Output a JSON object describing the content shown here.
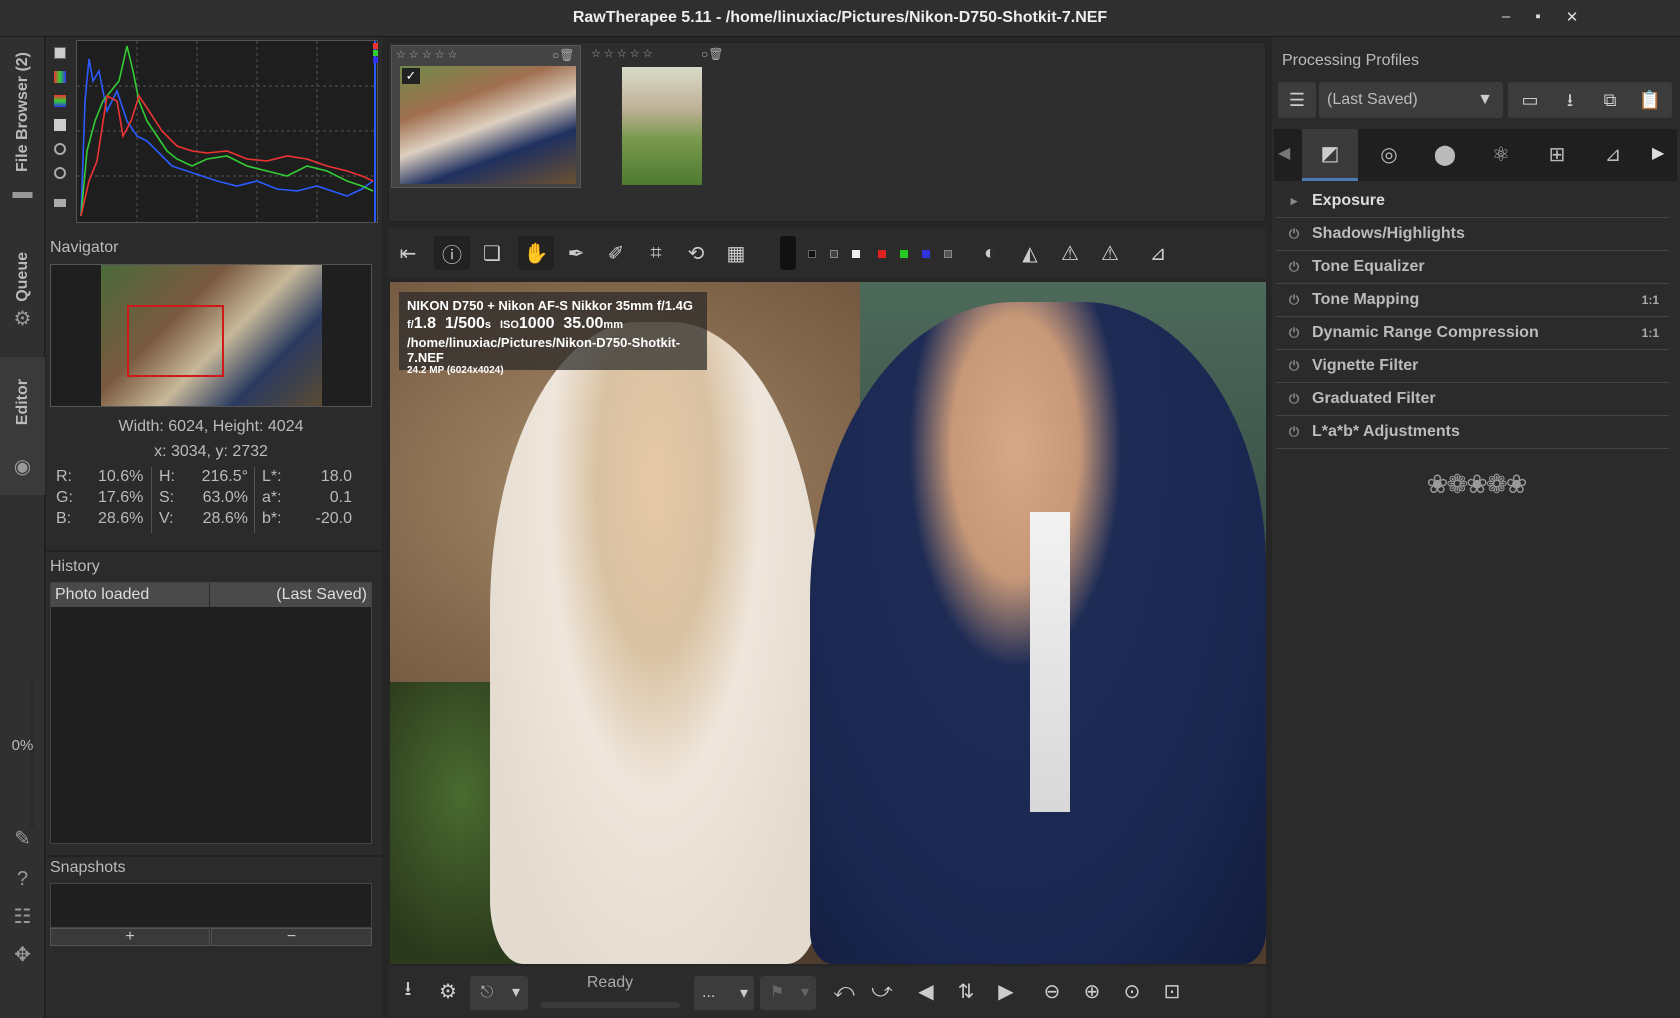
{
  "window": {
    "title": "RawTherapee 5.11 - /home/linuxiac/Pictures/Nikon-D750-Shotkit-7.NEF",
    "minimize": "–",
    "maximize": "▪",
    "close": "✕"
  },
  "left_tabs": {
    "file_browser": "File Browser (2)",
    "queue": "Queue",
    "editor": "Editor",
    "progress": "0%"
  },
  "navigator": {
    "title": "Navigator",
    "size": "Width: 6024, Height: 4024",
    "coords": "x: 3034, y: 2732",
    "values": [
      [
        "R:",
        "10.6%",
        "H:",
        "216.5°",
        "L*:",
        "18.0"
      ],
      [
        "G:",
        "17.6%",
        "S:",
        "63.0%",
        "a*:",
        "0.1"
      ],
      [
        "B:",
        "28.6%",
        "V:",
        "28.6%",
        "b*:",
        "-20.0"
      ]
    ]
  },
  "history": {
    "title": "History",
    "col1": "Photo loaded",
    "col2": "(Last Saved)"
  },
  "snapshots": {
    "title": "Snapshots",
    "add": "+",
    "remove": "−"
  },
  "filmstrip": {
    "stars": "☆ ☆ ☆ ☆ ☆"
  },
  "exif": {
    "line1": "NIKON D750 + Nikon AF-S Nikkor 35mm f/1.4G",
    "aperture_prefix": "f/",
    "aperture": "1.8",
    "shutter": "1/500",
    "shutter_unit": "s",
    "iso_prefix": "ISO",
    "iso": "1000",
    "focal": "35.00",
    "focal_unit": "mm",
    "path": "/home/linuxiac/Pictures/Nikon-D750-Shotkit-7.NEF",
    "mp": "24.2 MP (6024x4024)"
  },
  "bottom": {
    "status": "Ready",
    "ellipsis": "..."
  },
  "profiles": {
    "title": "Processing Profiles",
    "selected": "(Last Saved)"
  },
  "tools": [
    {
      "label": "Exposure",
      "right": "",
      "expander": "▸"
    },
    {
      "label": "Shadows/Highlights",
      "right": "",
      "expander": "⏻"
    },
    {
      "label": "Tone Equalizer",
      "right": "",
      "expander": "⏻"
    },
    {
      "label": "Tone Mapping",
      "right": "1:1",
      "expander": "⏻"
    },
    {
      "label": "Dynamic Range Compression",
      "right": "1:1",
      "expander": "⏻"
    },
    {
      "label": "Vignette Filter",
      "right": "",
      "expander": "⏻"
    },
    {
      "label": "Graduated Filter",
      "right": "",
      "expander": "⏻"
    },
    {
      "label": "L*a*b* Adjustments",
      "right": "",
      "expander": "⏻"
    }
  ],
  "ornament": "❀❁❀❁❀"
}
